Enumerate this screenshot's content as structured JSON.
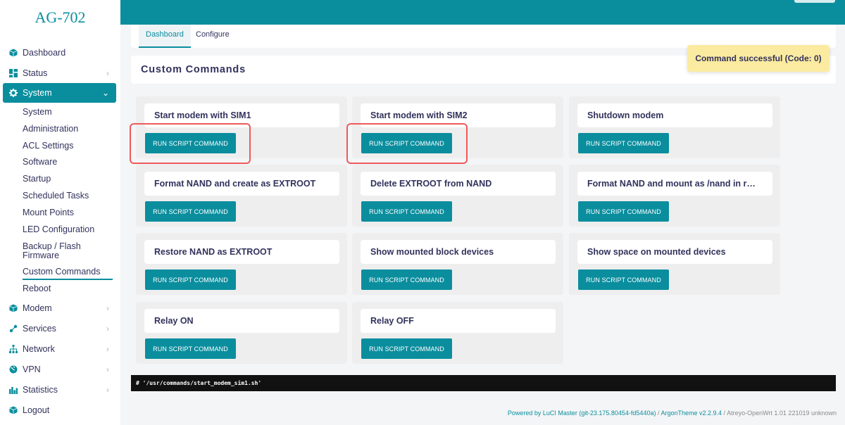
{
  "brand": "AG-702",
  "colors": {
    "accent": "#0a8e9e",
    "toast_bg": "#fbeba0",
    "highlight": "#ee5a5a"
  },
  "sidebar": {
    "items": [
      {
        "label": "Dashboard",
        "icon": "cube-icon",
        "chevron": false
      },
      {
        "label": "Status",
        "icon": "grid-icon",
        "chevron": true
      },
      {
        "label": "System",
        "icon": "gear-icon",
        "chevron": true,
        "active": true
      },
      {
        "label": "Modem",
        "icon": "cube-icon",
        "chevron": true
      },
      {
        "label": "Services",
        "icon": "share-icon",
        "chevron": true
      },
      {
        "label": "Network",
        "icon": "network-icon",
        "chevron": true
      },
      {
        "label": "VPN",
        "icon": "globe-icon",
        "chevron": true
      },
      {
        "label": "Statistics",
        "icon": "bar-chart-icon",
        "chevron": true
      },
      {
        "label": "Logout",
        "icon": "cube-icon",
        "chevron": false
      }
    ],
    "system_submenu": [
      "System",
      "Administration",
      "ACL Settings",
      "Software",
      "Startup",
      "Scheduled Tasks",
      "Mount Points",
      "LED Configuration",
      "Backup / Flash Firmware",
      "Custom Commands",
      "Reboot"
    ],
    "system_submenu_split": {
      "line1": "Backup / Flash",
      "line2": "Firmware"
    }
  },
  "tabs": [
    {
      "label": "Dashboard",
      "active": true
    },
    {
      "label": "Configure",
      "active": false
    }
  ],
  "page_title": "Custom Commands",
  "toast": "Command successful (Code: 0)",
  "commands": [
    {
      "title": "Start modem with SIM1",
      "button": "RUN SCRIPT COMMAND"
    },
    {
      "title": "Start modem with SIM2",
      "button": "RUN SCRIPT COMMAND"
    },
    {
      "title": "Shutdown modem",
      "button": "RUN SCRIPT COMMAND"
    },
    {
      "title": "Format NAND and create as EXTROOT",
      "button": "RUN SCRIPT COMMAND"
    },
    {
      "title": "Delete EXTROOT from NAND",
      "button": "RUN SCRIPT COMMAND"
    },
    {
      "title": "Format NAND and mount as /nand in r…",
      "button": "RUN SCRIPT COMMAND"
    },
    {
      "title": "Restore NAND as EXTROOT",
      "button": "RUN SCRIPT COMMAND"
    },
    {
      "title": "Show mounted block devices",
      "button": "RUN SCRIPT COMMAND"
    },
    {
      "title": "Show space on mounted devices",
      "button": "RUN SCRIPT COMMAND"
    },
    {
      "title": "Relay ON",
      "button": "RUN SCRIPT COMMAND"
    },
    {
      "title": "Relay OFF",
      "button": "RUN SCRIPT COMMAND"
    }
  ],
  "output": "# '/usr/commands/start_modem_sim1.sh'",
  "footer": {
    "powered": "Powered by LuCI Master (git-23.175.80454-fd5440a)",
    "sep1": " / ",
    "theme": "ArgonTheme v2.2.9.4",
    "sep2": " / ",
    "version": "Atreyo-OpenWrt 1.01 221019 unknown"
  }
}
